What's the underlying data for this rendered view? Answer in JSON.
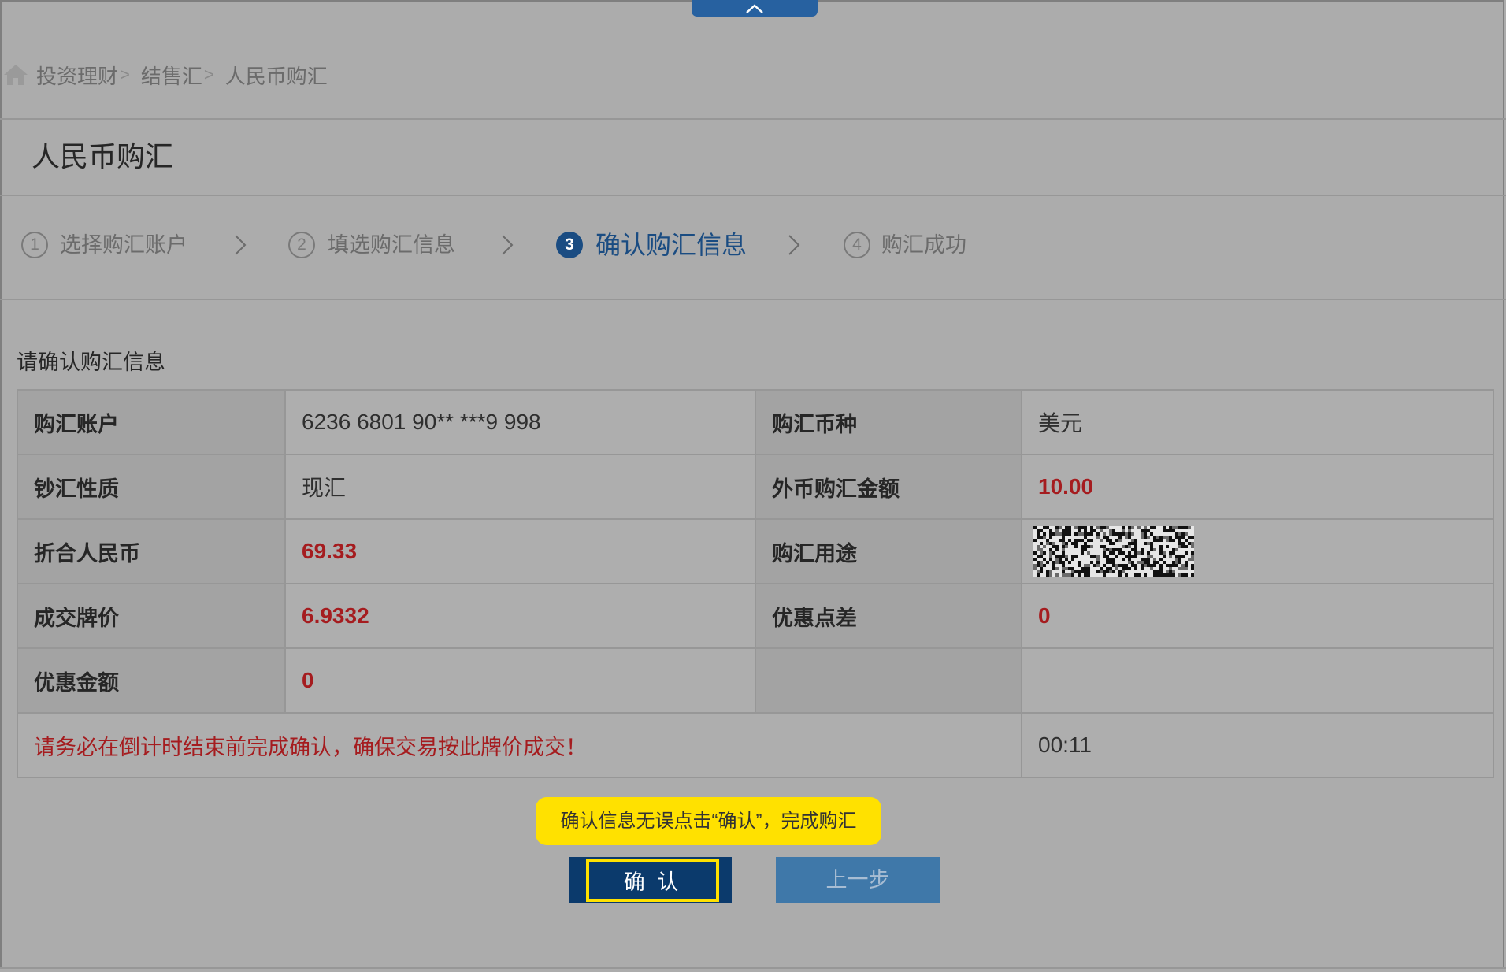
{
  "colors": {
    "page_overlay": "#acacac",
    "accent_blue": "#1a4c82",
    "emphasis_red": "#a51c1f",
    "tooltip_yellow": "#ffe100",
    "confirm_button": "#0b3a6c",
    "back_button": "#3f78a9"
  },
  "collapse_tab": {
    "icon": "chevron-up-icon"
  },
  "breadcrumb": {
    "icon": "home-icon",
    "items": [
      "投资理财",
      "结售汇",
      "人民币购汇"
    ],
    "separator": ">"
  },
  "page_title": "人民币购汇",
  "steps": [
    {
      "number": "1",
      "label": "选择购汇账户",
      "active": false
    },
    {
      "number": "2",
      "label": "填选购汇信息",
      "active": false
    },
    {
      "number": "3",
      "label": "确认购汇信息",
      "active": true
    },
    {
      "number": "4",
      "label": "购汇成功",
      "active": false
    }
  ],
  "step_separator_icon": "chevron-right-icon",
  "section_title": "请确认购汇信息",
  "table": {
    "rows": [
      {
        "label_a": "购汇账户",
        "value_a": "6236 6801 90** ***9 998",
        "label_b": "购汇币种",
        "value_b": "美元"
      },
      {
        "label_a": "钞汇性质",
        "value_a": "现汇",
        "label_b": "外币购汇金额",
        "value_b": "10.00"
      },
      {
        "label_a": "折合人民币",
        "value_a": "69.33",
        "label_b": "购汇用途"
      },
      {
        "label_a": "成交牌价",
        "value_a": "6.9332",
        "label_b": "优惠点差",
        "value_b": "0"
      },
      {
        "label_a": "优惠金额",
        "value_a": "0"
      }
    ]
  },
  "countdown": {
    "warning": "请务必在倒计时结束前完成确认，确保交易按此牌价成交！",
    "time": "00:11"
  },
  "tooltip": "确认信息无误点击“确认”，完成购汇",
  "buttons": {
    "confirm": "确 认",
    "back": "上一步"
  }
}
